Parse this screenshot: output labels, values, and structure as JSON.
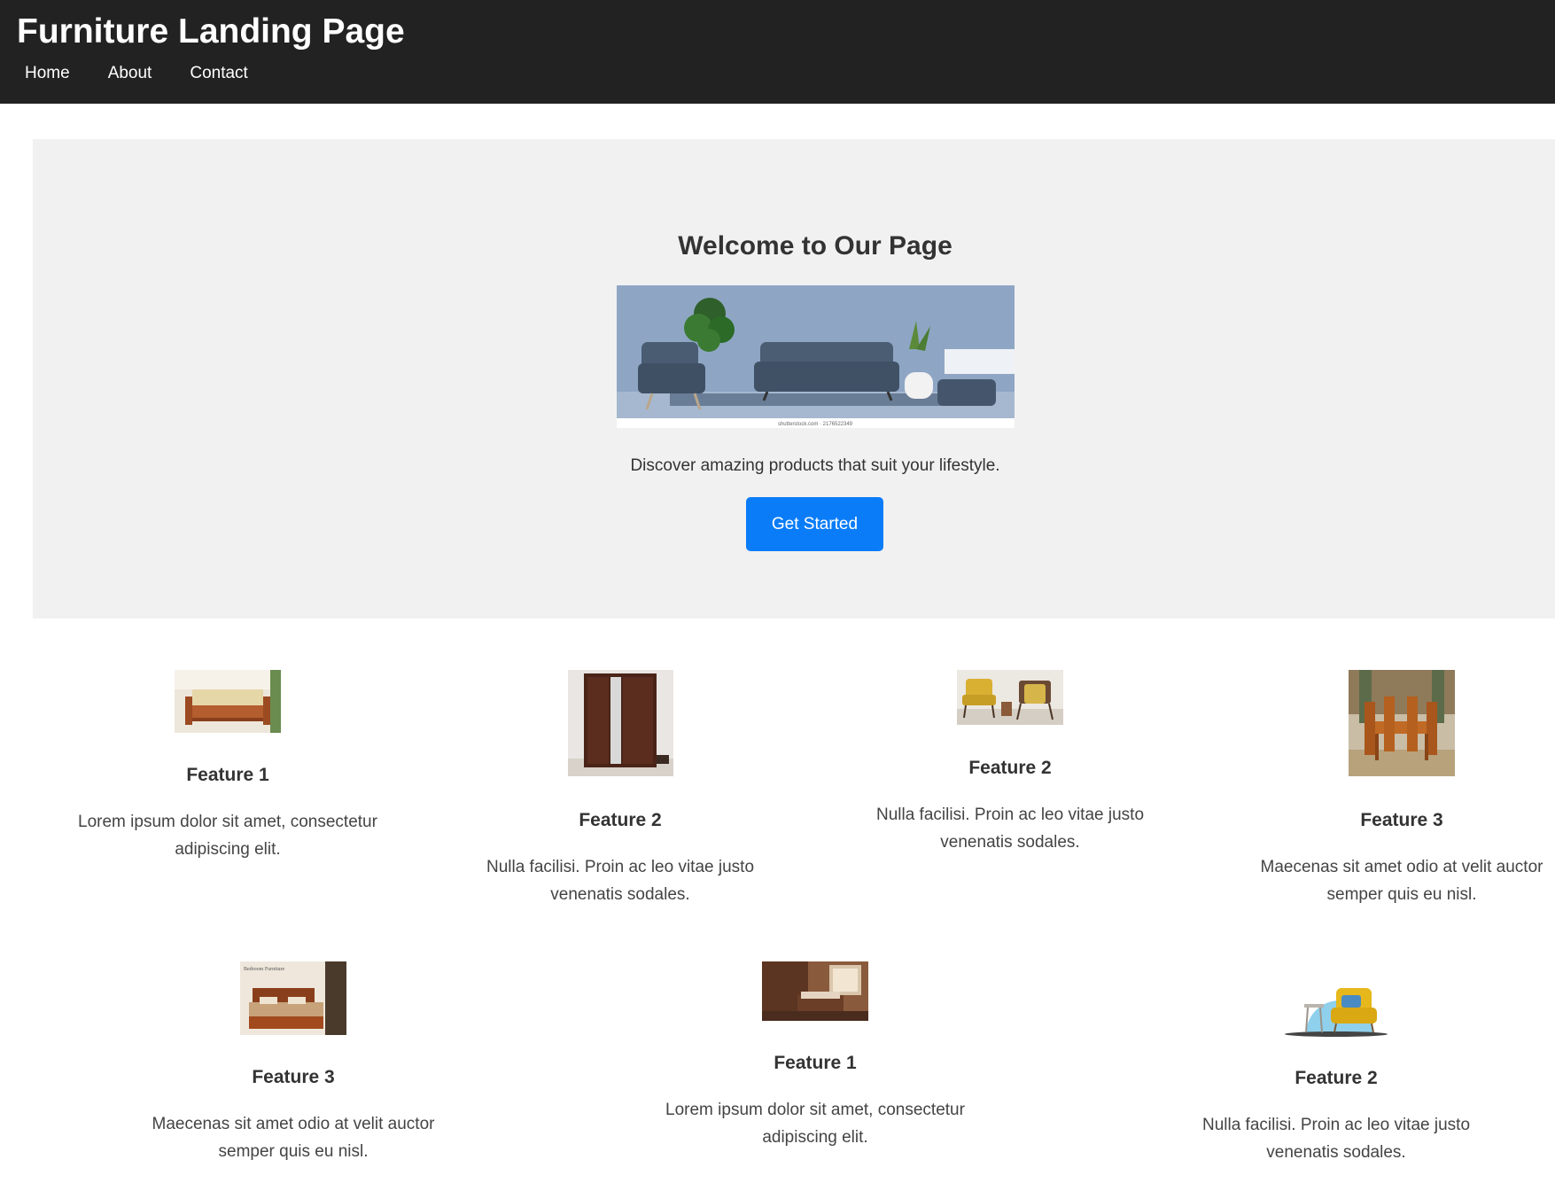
{
  "header": {
    "title": "Furniture Landing Page",
    "nav": [
      "Home",
      "About",
      "Contact"
    ]
  },
  "hero": {
    "title": "Welcome to Our Page",
    "image_icon": "living-room-sofa-set-image",
    "image_caption": "shutterstock.com · 2176522349",
    "text": "Discover amazing products that suit your lifestyle.",
    "button_label": "Get Started"
  },
  "features": [
    {
      "title": "Feature 1",
      "text_line1": "Lorem ipsum dolor sit amet, consectetur",
      "text_line2": "adipiscing elit.",
      "image_icon": "wooden-sofa-image"
    },
    {
      "title": "Feature 2",
      "text_line1": "Nulla facilisi. Proin ac leo vitae justo",
      "text_line2": "venenatis sodales.",
      "image_icon": "wardrobe-image"
    },
    {
      "title": "Feature 2",
      "text_line1": "Nulla facilisi. Proin ac leo vitae justo",
      "text_line2": "venenatis sodales.",
      "image_icon": "armchairs-image"
    },
    {
      "title": "Feature 3",
      "text_line1": "Maecenas sit amet odio at velit auctor",
      "text_line2": "semper quis eu nisl.",
      "image_icon": "dining-set-image"
    },
    {
      "title": "Feature 3",
      "text_line1": "Maecenas sit amet odio at velit auctor",
      "text_line2": "semper quis eu nisl.",
      "image_icon": "bed-image",
      "image_text": "Bedroom Furniture"
    },
    {
      "title": "Feature 1",
      "text_line1": "Lorem ipsum dolor sit amet, consectetur",
      "text_line2": "adipiscing elit.",
      "image_icon": "bedroom-interior-image"
    },
    {
      "title": "Feature 2",
      "text_line1": "Nulla facilisi. Proin ac leo vitae justo",
      "text_line2": "venenatis sodales.",
      "image_icon": "yellow-armchair-image"
    }
  ],
  "colors": {
    "header_bg": "#222222",
    "hero_bg": "#f1f1f1",
    "accent": "#0a7cf8"
  }
}
